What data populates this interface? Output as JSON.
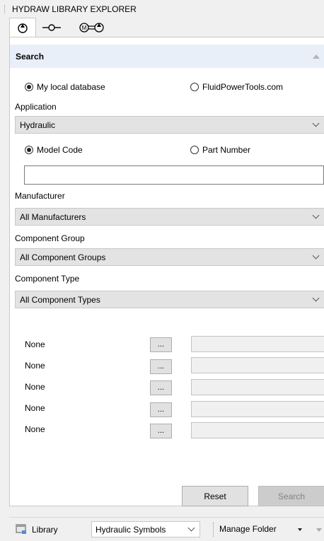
{
  "window": {
    "title": "HYDRAW LIBRARY EXPLORER"
  },
  "tabs": [
    {
      "icon": "pump-symbol-icon"
    },
    {
      "icon": "valve-symbol-icon"
    },
    {
      "icon": "motor-pump-symbol-icon"
    }
  ],
  "search": {
    "header": "Search",
    "source_local": "My local database",
    "source_online": "FluidPowerTools.com",
    "application_label": "Application",
    "application_value": "Hydraulic",
    "model_code": "Model Code",
    "part_number": "Part Number",
    "query_value": "",
    "manufacturer_label": "Manufacturer",
    "manufacturer_value": "All Manufacturers",
    "group_label": "Component Group",
    "group_value": "All Component Groups",
    "type_label": "Component Type",
    "type_value": "All Component Types",
    "attributes": [
      {
        "label": "None",
        "button": "...",
        "value": ""
      },
      {
        "label": "None",
        "button": "...",
        "value": ""
      },
      {
        "label": "None",
        "button": "...",
        "value": ""
      },
      {
        "label": "None",
        "button": "...",
        "value": ""
      },
      {
        "label": "None",
        "button": "...",
        "value": ""
      }
    ],
    "reset_label": "Reset",
    "search_label": "Search"
  },
  "footer": {
    "library_label": "Library",
    "library_value": "Hydraulic Symbols",
    "manage_label": "Manage Folder"
  }
}
